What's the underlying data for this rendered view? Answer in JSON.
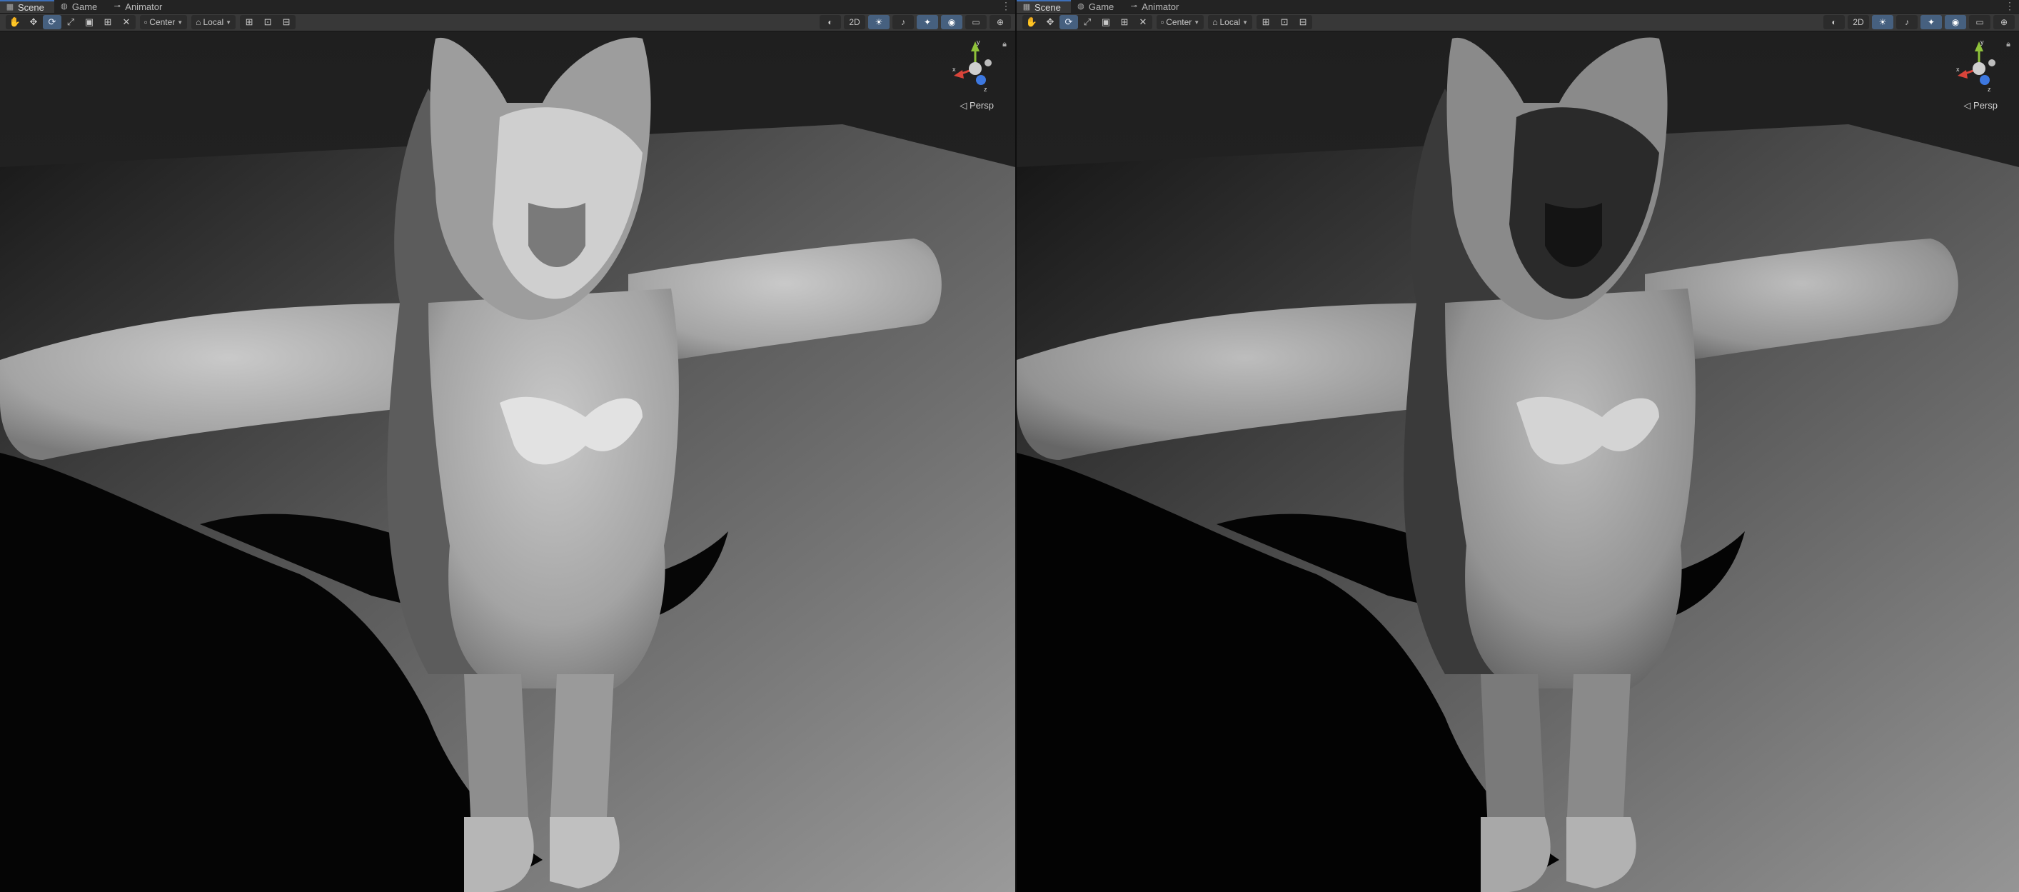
{
  "tabs": [
    {
      "label": "Scene",
      "icon": "scene-icon",
      "active": true
    },
    {
      "label": "Game",
      "icon": "game-controller-icon",
      "active": false
    },
    {
      "label": "Animator",
      "icon": "animator-icon",
      "active": false
    }
  ],
  "toolbar": {
    "tools": [
      "hand-tool-icon",
      "move-tool-icon",
      "rotate-tool-icon",
      "scale-tool-icon",
      "rect-tool-icon",
      "transform-tool-icon",
      "custom-tool-icon"
    ],
    "active_tool": "rotate-tool-icon",
    "pivot_mode": "Center",
    "pivot_rotation": "Local",
    "mode_2d": "2D"
  },
  "viewport": {
    "projection": "Persp",
    "gizmo_axes": {
      "y": "y",
      "x": "x",
      "z": "z"
    }
  },
  "colors": {
    "accent": "#46607f",
    "axis_x": "#d9443a",
    "axis_y": "#8fc23a",
    "axis_z": "#3d78e0"
  }
}
